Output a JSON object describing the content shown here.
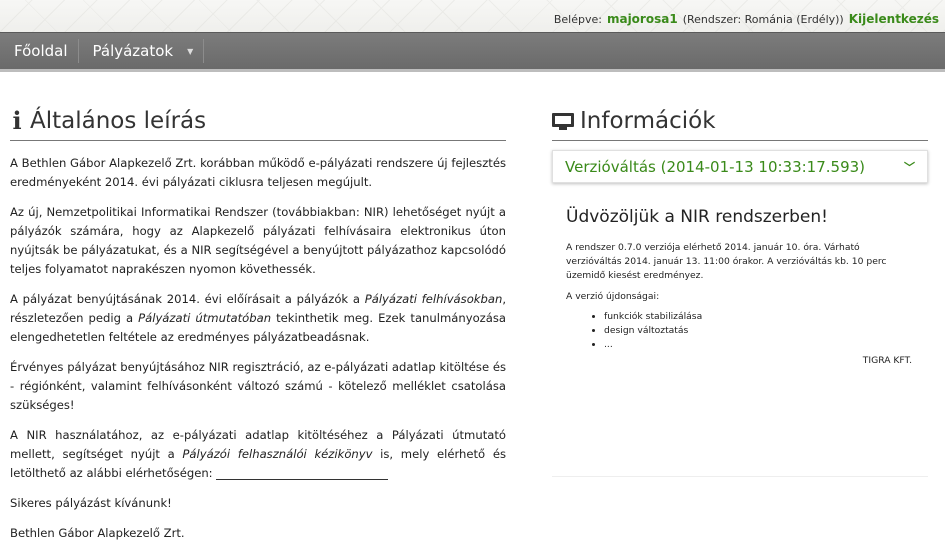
{
  "header": {
    "login_label": "Belépve:",
    "username": "majorosa1",
    "system": "(Rendszer: Románia (Erdély))",
    "logout": "Kijelentkezés"
  },
  "nav": {
    "home": "Főoldal",
    "applications": "Pályázatok"
  },
  "left": {
    "title": "Általános leírás",
    "p1": "A Bethlen Gábor Alapkezelő Zrt. korábban működő e-pályázati rendszere új fejlesztés eredményeként 2014. évi pályázati ciklusra teljesen megújult.",
    "p2": "Az új, Nemzetpolitikai Informatikai Rendszer (továbbiakban: NIR) lehetőséget nyújt a pályázók számára, hogy az Alapkezelő pályázati felhívásaira elektronikus úton nyújtsák be pályázatukat, és a NIR segítségével a benyújtott pályázathoz kapcsolódó teljes folyamatot naprakészen nyomon követhessék.",
    "p3_a": "A pályázat benyújtásának 2014. évi előírásait a pályázók a ",
    "p3_i1": "Pályázati felhívásokban",
    "p3_b": ", részletezően pedig a ",
    "p3_i2": "Pályázati útmutatóban",
    "p3_c": " tekinthetik meg. Ezek tanulmányozása elengedhetetlen feltétele az eredményes pályázatbeadásnak.",
    "p4": "Érvényes pályázat benyújtásához NIR regisztráció, az e-pályázati adatlap kitöltése és - régiónként, valamint felhívásonként változó számú - kötelező melléklet csatolása szükséges!",
    "p5_a": "A NIR használatához, az e-pályázati adatlap kitöltéséhez a Pályázati útmutató mellett, segítséget nyújt a ",
    "p5_i": "Pályázói felhasználói kézikönyv",
    "p5_b": " is, mely elérhető és letölthető az alábbi elérhetőségen: ",
    "p6": "Sikeres pályázást kívánunk!",
    "p7": "Bethlen Gábor Alapkezelő Zrt."
  },
  "right": {
    "title": "Információk",
    "accordion_title": "Verzióváltás (2014-01-13 10:33:17.593)",
    "welcome": "Üdvözöljük a NIR rendszerben!",
    "version_text": "A rendszer 0.7.0 verziója elérhető 2014. január 10. óra. Várható verzióváltás 2014. január 13. 11:00 órakor. A verzióváltás kb. 10 perc üzemidő kiesést eredményez.",
    "news_label": "A verzió újdonságai:",
    "news_items": [
      "funkciók stabilizálása",
      "design változtatás",
      "..."
    ],
    "signature": "TIGRA KFT."
  },
  "colors": {
    "accent_green": "#3a8a1a",
    "navbar": "#737373"
  },
  "icons": {
    "info": "info-icon",
    "monitor": "monitor-icon",
    "chevron": "chevron-down-icon"
  }
}
